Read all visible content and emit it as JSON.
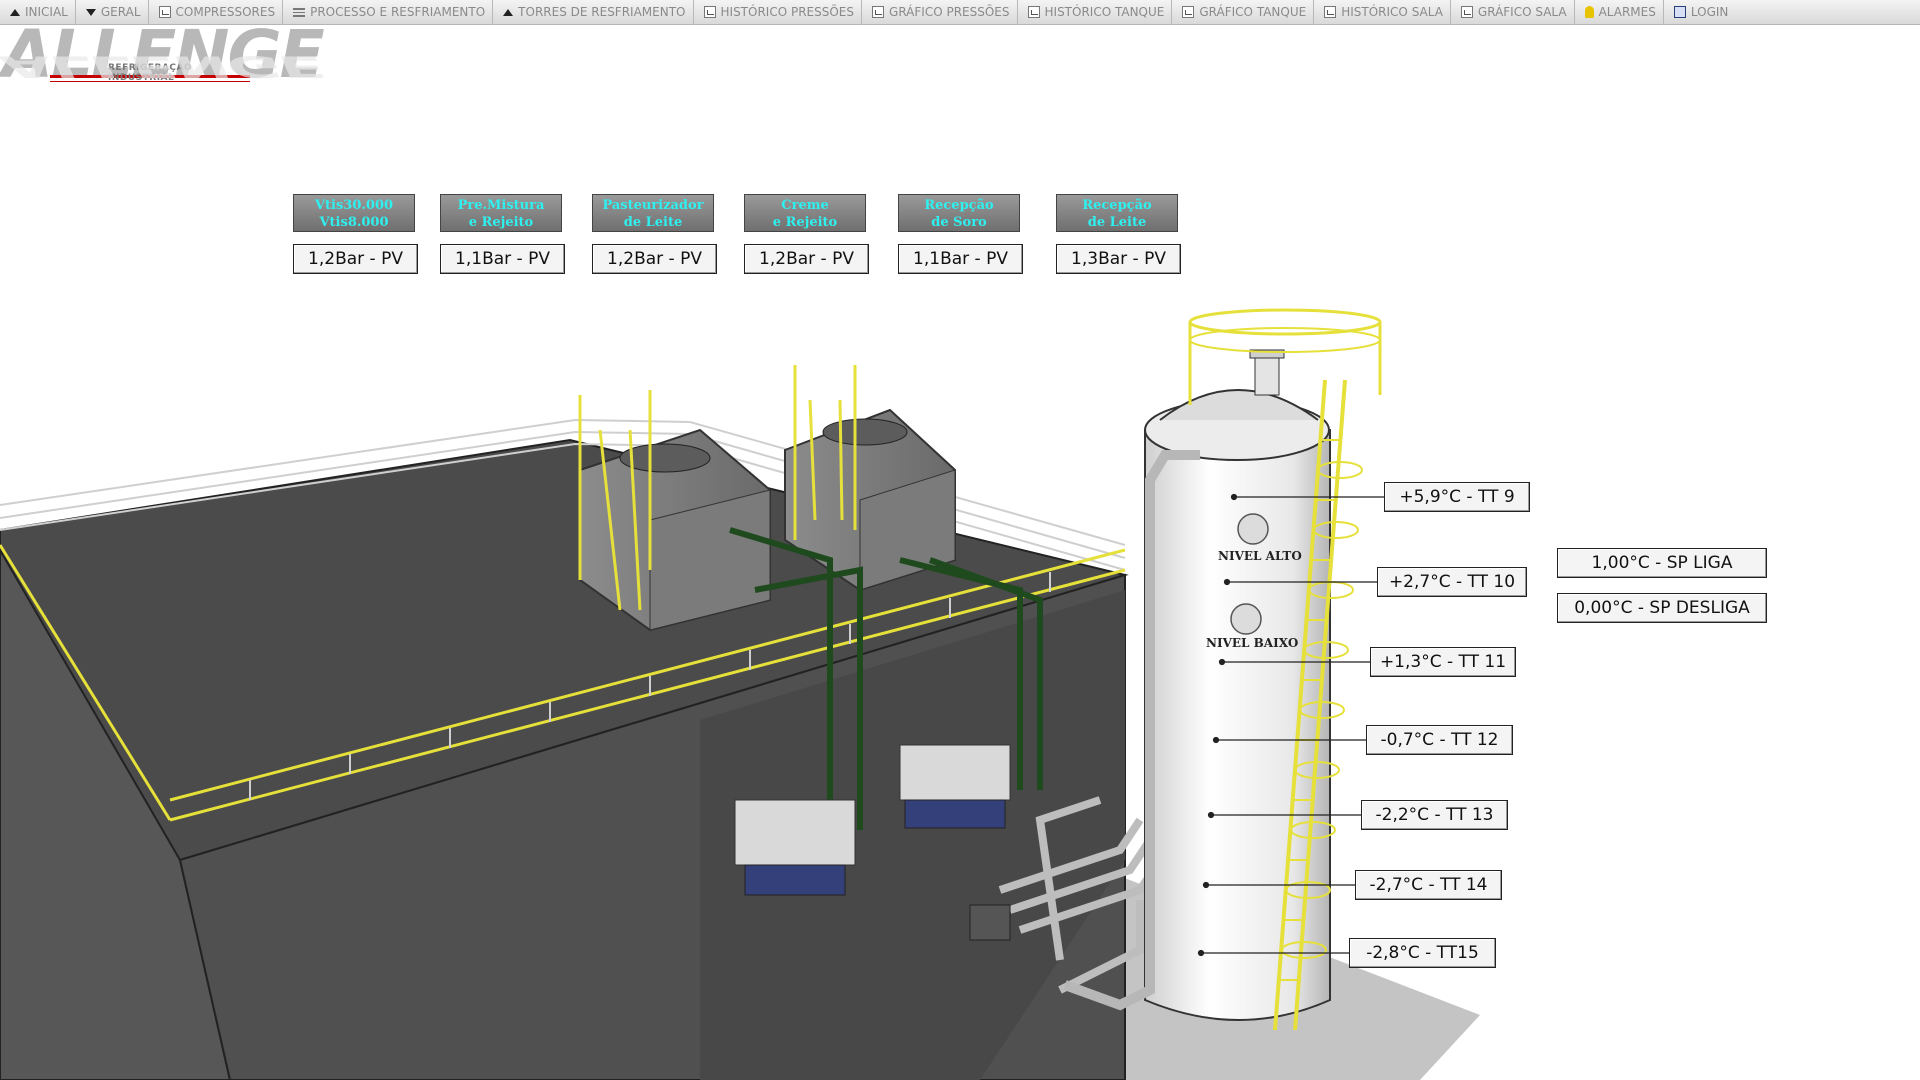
{
  "nav": {
    "items": [
      {
        "label": "INICIAL",
        "icon": "triangle-up-icon"
      },
      {
        "label": "GERAL",
        "icon": "triangle-down-icon"
      },
      {
        "label": "COMPRESSORES",
        "icon": "document-icon"
      },
      {
        "label": "PROCESSO E RESFRIAMENTO",
        "icon": "list-icon"
      },
      {
        "label": "TORRES DE RESFRIAMENTO",
        "icon": "triangle-up-icon"
      },
      {
        "label": "HISTÓRICO PRESSÕES",
        "icon": "chart-icon"
      },
      {
        "label": "GRÁFICO PRESSÕES",
        "icon": "chart-icon"
      },
      {
        "label": "HISTÓRICO TANQUE",
        "icon": "chart-icon"
      },
      {
        "label": "GRÁFICO TANQUE",
        "icon": "chart-icon"
      },
      {
        "label": "HISTÓRICO SALA",
        "icon": "chart-icon"
      },
      {
        "label": "GRÁFICO SALA",
        "icon": "chart-icon"
      },
      {
        "label": "ALARMES",
        "icon": "bell-icon"
      },
      {
        "label": "LOGIN",
        "icon": "login-icon"
      }
    ]
  },
  "logo": {
    "name": "ALLENGE",
    "tagline": "REFRIGERAÇÃO INDUSTRIAL",
    "registered": "®"
  },
  "sectors": [
    {
      "line1": "Vtis30.000",
      "line2": "Vtis8.000",
      "pressure": "1,2Bar - PV"
    },
    {
      "line1": "Pre.Mistura",
      "line2": "e Rejeito",
      "pressure": "1,1Bar - PV"
    },
    {
      "line1": "Pasteurizador",
      "line2": "de Leite",
      "pressure": "1,2Bar - PV"
    },
    {
      "line1": "Creme",
      "line2": "e Rejeito",
      "pressure": "1,2Bar - PV"
    },
    {
      "line1": "Recepção",
      "line2": "de Soro",
      "pressure": "1,1Bar - PV"
    },
    {
      "line1": "Recepção",
      "line2": "de Leite",
      "pressure": "1,3Bar - PV"
    }
  ],
  "tank": {
    "level_high": "NIVEL ALTO",
    "level_low": "NIVEL BAIXO",
    "temperatures": [
      "+5,9°C - TT 9",
      "+2,7°C - TT 10",
      "+1,3°C - TT 11",
      "-0,7°C - TT 12",
      "-2,2°C - TT 13",
      "-2,7°C - TT 14",
      "-2,8°C - TT15"
    ],
    "setpoints": {
      "on": "1,00°C - SP LIGA",
      "off": "0,00°C - SP DESLIGA"
    }
  },
  "colors": {
    "sector_text": "#2ff0f0",
    "ladder": "#e6e03a",
    "floor_dark": "#4a4a4a",
    "pipe_green": "#1e4a1e"
  }
}
